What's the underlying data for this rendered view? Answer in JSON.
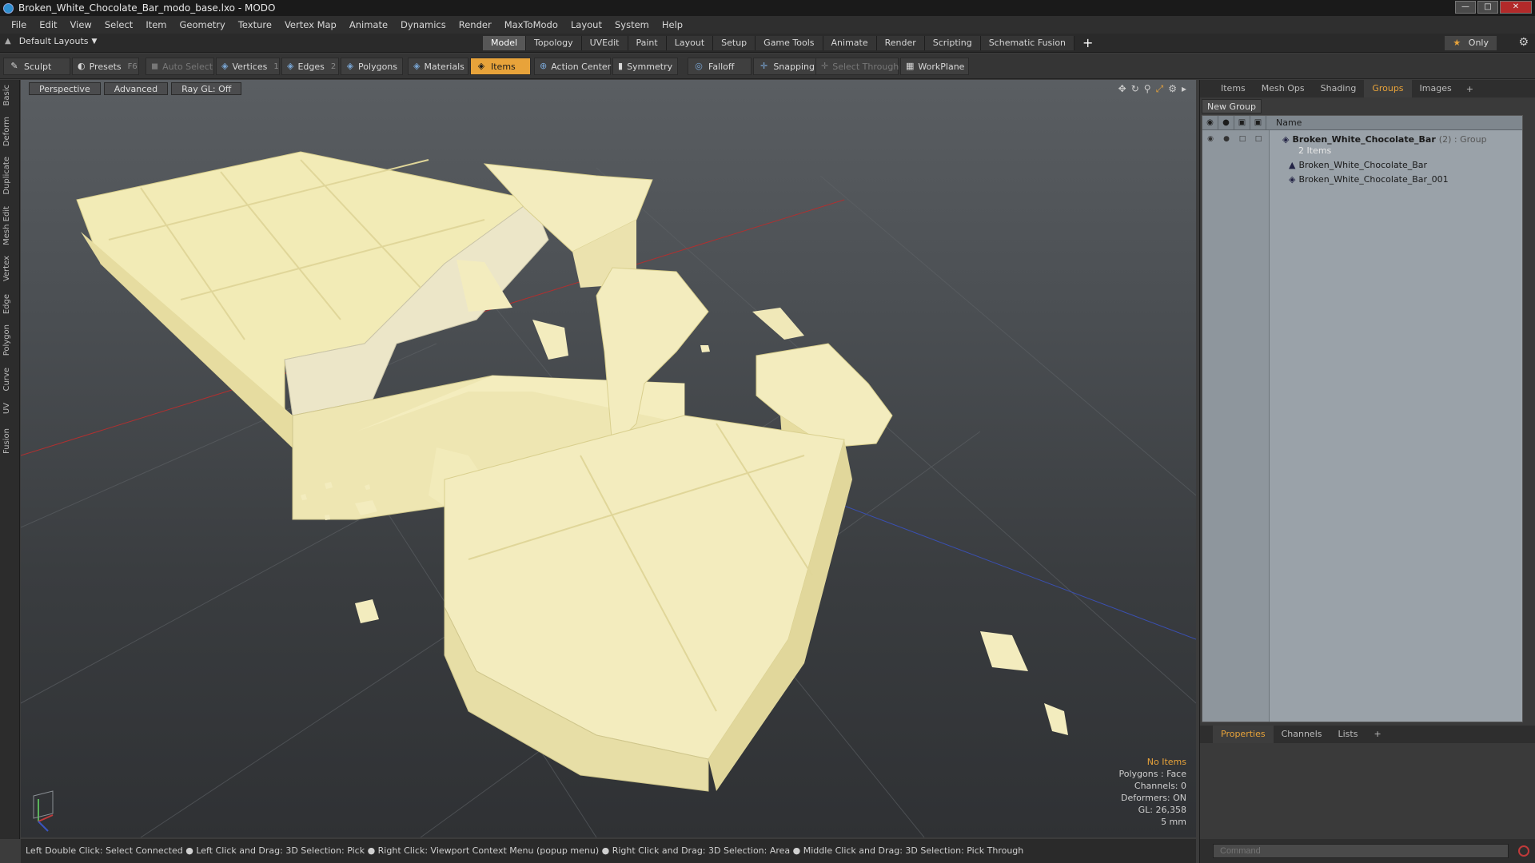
{
  "window": {
    "title": "Broken_White_Chocolate_Bar_modo_base.lxo - MODO"
  },
  "menu": [
    "File",
    "Edit",
    "View",
    "Select",
    "Item",
    "Geometry",
    "Texture",
    "Vertex Map",
    "Animate",
    "Dynamics",
    "Render",
    "MaxToModo",
    "Layout",
    "System",
    "Help"
  ],
  "layout": {
    "dropdown": "Default Layouts",
    "tabs": [
      {
        "label": "Model",
        "active": true
      },
      {
        "label": "Topology"
      },
      {
        "label": "UVEdit"
      },
      {
        "label": "Paint"
      },
      {
        "label": "Layout"
      },
      {
        "label": "Setup"
      },
      {
        "label": "Game Tools"
      },
      {
        "label": "Animate"
      },
      {
        "label": "Render"
      },
      {
        "label": "Scripting"
      },
      {
        "label": "Schematic Fusion"
      }
    ],
    "only_label": "Only"
  },
  "toolbar": {
    "sculpt": "Sculpt",
    "presets": "Presets",
    "presets_key": "F6",
    "auto_select": "Auto Select",
    "vertices": "Vertices",
    "vertices_count": "1",
    "edges": "Edges",
    "edges_count": "2",
    "polygons": "Polygons",
    "materials": "Materials",
    "items": "Items",
    "action_center": "Action Center",
    "symmetry": "Symmetry",
    "falloff": "Falloff",
    "snapping": "Snapping",
    "select_through": "Select Through",
    "workplane": "WorkPlane"
  },
  "left_tabs": [
    "Basic",
    "Deform",
    "Duplicate",
    "Mesh Edit",
    "Vertex",
    "Edge",
    "Polygon",
    "Curve",
    "UV",
    "Fusion"
  ],
  "viewport": {
    "perspective": "Perspective",
    "advanced": "Advanced",
    "raygl": "Ray GL: Off",
    "info": {
      "items": "No Items",
      "polygons": "Polygons : Face",
      "channels": "Channels: 0",
      "deformers": "Deformers: ON",
      "gl": "GL: 26,358",
      "scale": "5 mm"
    }
  },
  "status": "Left Double Click: Select Connected ● Left Click and Drag: 3D Selection: Pick ● Right Click: Viewport Context Menu (popup menu) ● Right Click and Drag: 3D Selection: Area ● Middle Click and Drag: 3D Selection: Pick Through",
  "right_panel": {
    "tabs": [
      {
        "label": "Items"
      },
      {
        "label": "Mesh Ops"
      },
      {
        "label": "Shading"
      },
      {
        "label": "Groups",
        "active": true
      },
      {
        "label": "Images"
      }
    ],
    "new_group": "New Group",
    "name_header": "Name",
    "group": {
      "name": "Broken_White_Chocolate_Bar",
      "suffix": "(2) : Group",
      "sub": "2 Items"
    },
    "children": [
      "Broken_White_Chocolate_Bar",
      "Broken_White_Chocolate_Bar_001"
    ],
    "bottom_tabs": [
      {
        "label": "Properties",
        "active": true
      },
      {
        "label": "Channels"
      },
      {
        "label": "Lists"
      }
    ],
    "command_placeholder": "Command"
  },
  "colors": {
    "accent": "#e8a33a",
    "chocolate": "#f3ecb8",
    "chocolate_shade": "#dcd49a"
  }
}
